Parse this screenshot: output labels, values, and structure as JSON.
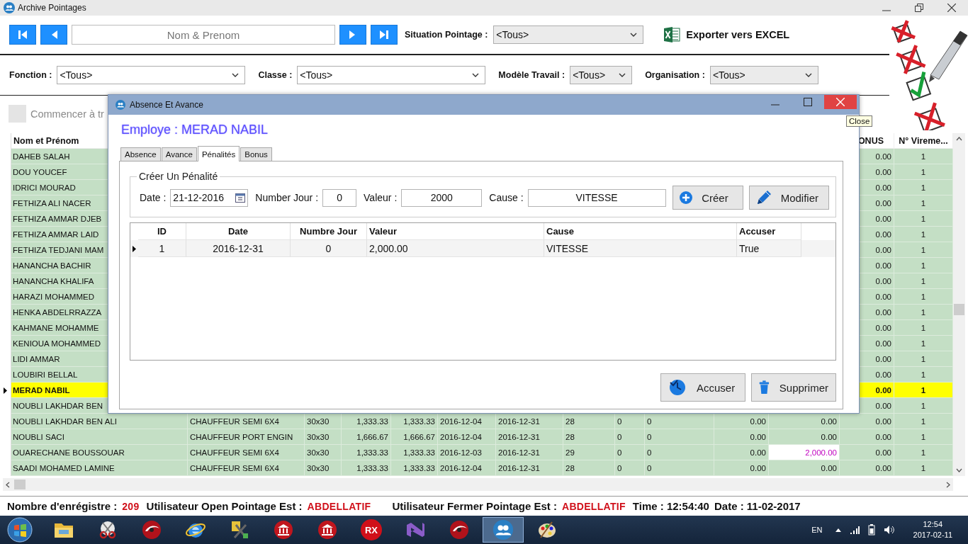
{
  "window": {
    "title": "Archive Pointages"
  },
  "search": {
    "placeholder": "Nom & Prenom"
  },
  "situation": {
    "label": "Situation Pointage :",
    "value": "<Tous>"
  },
  "export": {
    "label": "Exporter vers EXCEL"
  },
  "filters": [
    {
      "label": "Fonction :",
      "value": "<Tous>"
    },
    {
      "label": "Classe :",
      "value": "<Tous>"
    },
    {
      "label": "Modèle Travail :",
      "value": "<Tous>"
    },
    {
      "label": "Organisation :",
      "value": "<Tous>"
    }
  ],
  "start_option": {
    "label": "Commencer à tr",
    "checked": false
  },
  "table": {
    "columns": [
      {
        "label": "Nom et Prénom"
      },
      {
        "label": "ONUS"
      },
      {
        "label": "N° Vireme..."
      }
    ],
    "rows": [
      {
        "name": "DAHEB SALAH",
        "selected": false,
        "last_columns": [
          "0.00",
          "1"
        ]
      },
      {
        "name": "DOU YOUCEF",
        "selected": false,
        "last_columns": [
          "0.00",
          "1"
        ]
      },
      {
        "name": "IDRICI MOURAD",
        "selected": false,
        "last_columns": [
          "0.00",
          "1"
        ]
      },
      {
        "name": "FETHIZA ALI  NACER",
        "selected": false,
        "last_columns": [
          "0.00",
          "1"
        ]
      },
      {
        "name": "FETHIZA AMMAR DJEB",
        "selected": false,
        "last_columns": [
          "0.00",
          "1"
        ]
      },
      {
        "name": "FETHIZA AMMAR LAID",
        "selected": false,
        "last_columns": [
          "0.00",
          "1"
        ]
      },
      {
        "name": "FETHIZA TEDJANI MAM",
        "selected": false,
        "last_columns": [
          "0.00",
          "1"
        ]
      },
      {
        "name": "HANANCHA BACHIR",
        "selected": false,
        "last_columns": [
          "0.00",
          "1"
        ]
      },
      {
        "name": "HANANCHA KHALIFA",
        "selected": false,
        "last_columns": [
          "0.00",
          "1"
        ]
      },
      {
        "name": "HARAZI MOHAMMED",
        "selected": false,
        "last_columns": [
          "0.00",
          "1"
        ]
      },
      {
        "name": "HENKA ABDELRRAZZA",
        "selected": false,
        "last_columns": [
          "0.00",
          "1"
        ]
      },
      {
        "name": "KAHMANE  MOHAMME",
        "selected": false,
        "last_columns": [
          "0.00",
          "1"
        ]
      },
      {
        "name": "KENIOUA MOHAMMED",
        "selected": false,
        "last_columns": [
          "0.00",
          "1"
        ]
      },
      {
        "name": "LIDI AMMAR",
        "selected": false,
        "last_columns": [
          "0.00",
          "1"
        ]
      },
      {
        "name": "LOUBIRI BELLAL",
        "selected": false,
        "last_columns": [
          "0.00",
          "1"
        ]
      },
      {
        "name": "MERAD NABIL",
        "selected": true,
        "last_columns": [
          "0.00",
          "1"
        ]
      },
      {
        "name": "NOUBLI LAKHDAR BEN",
        "selected": false,
        "last_columns": [
          "0.00",
          "1"
        ]
      },
      {
        "name": "NOUBLI LAKHDAR BEN ALI",
        "selected": false,
        "details": [
          "CHAUFFEUR SEMI 6X4",
          "30x30",
          "1,333.33",
          "1,333.33",
          "2016-12-04",
          "2016-12-31",
          "28",
          "0",
          "0",
          "0.00"
        ],
        "penalty": {
          "text": "0.00",
          "highlighted": false
        },
        "last_columns": [
          "0.00",
          "1"
        ]
      },
      {
        "name": "NOUBLI  SACI",
        "selected": false,
        "details": [
          "CHAUFFEUR PORT ENGIN",
          "30x30",
          "1,666.67",
          "1,666.67",
          "2016-12-04",
          "2016-12-31",
          "28",
          "0",
          "0",
          "0.00"
        ],
        "penalty": {
          "text": "0.00",
          "highlighted": false
        },
        "last_columns": [
          "0.00",
          "1"
        ]
      },
      {
        "name": "OUARECHANE BOUSSOUAR",
        "selected": false,
        "details": [
          "CHAUFFEUR SEMI 6X4",
          "30x30",
          "1,333.33",
          "1,333.33",
          "2016-12-03",
          "2016-12-31",
          "29",
          "0",
          "0",
          "0.00"
        ],
        "penalty": {
          "text": "2,000.00",
          "highlighted": true
        },
        "last_columns": [
          "0.00",
          "1"
        ]
      },
      {
        "name": "SAADI MOHAMED LAMINE",
        "selected": false,
        "details": [
          "CHAUFFEUR SEMI 6X4",
          "30x30",
          "1,333.33",
          "1,333.33",
          "2016-12-04",
          "2016-12-31",
          "28",
          "0",
          "0",
          "0.00"
        ],
        "penalty": {
          "text": "0.00",
          "highlighted": false
        },
        "last_columns": [
          "0.00",
          "1"
        ]
      }
    ]
  },
  "dialog": {
    "title": "Absence Et Avance",
    "employee": "Employe : MERAD NABIL",
    "tabs": [
      {
        "label": "Absence",
        "selected": false
      },
      {
        "label": "Avance",
        "selected": false
      },
      {
        "label": "Pénalités",
        "selected": true
      },
      {
        "label": "Bonus",
        "selected": false
      }
    ],
    "group": {
      "title": "Créer Un Pénalité",
      "fields": [
        {
          "label": "Date :",
          "value": "21-12-2016",
          "kind": "date"
        },
        {
          "label": "Number Jour :",
          "value": "0",
          "kind": "text"
        },
        {
          "label": "Valeur :",
          "value": "2000",
          "kind": "text"
        },
        {
          "label": "Cause :",
          "value": "VITESSE",
          "kind": "text"
        }
      ],
      "buttons": [
        {
          "label": "Créer",
          "kind": "create"
        },
        {
          "label": "Modifier",
          "kind": "edit"
        }
      ]
    },
    "grid": {
      "columns": [
        "ID",
        "Date",
        "Numbre Jour",
        "Valeur",
        "Cause",
        "Accuser"
      ],
      "rows": [
        {
          "cells": [
            "1",
            "2016-12-31",
            "0",
            "2,000.00",
            "VITESSE",
            "True"
          ],
          "selected": true
        }
      ]
    },
    "buttons": [
      {
        "label": "Accuser",
        "kind": "accuse"
      },
      {
        "label": "Supprimer",
        "kind": "delete"
      }
    ]
  },
  "tooltip": {
    "text": "Close"
  },
  "status_bar": {
    "items": [
      {
        "label": "Nombre d'enrégistre :",
        "value": "209"
      },
      {
        "label": "Utilisateur Open Pointage Est :",
        "value": "ABDELLATIF"
      },
      {
        "label": "Utilisateur Fermer Pointage Est :",
        "value": "ABDELLATIF"
      }
    ],
    "time": "Time : 12:54:40",
    "date": "Date : 11-02-2017"
  },
  "taskbar": {
    "apps": [
      {
        "kind": "folder",
        "active": false
      },
      {
        "kind": "scissors",
        "active": false
      },
      {
        "kind": "disc",
        "active": false
      },
      {
        "kind": "browser",
        "active": false
      },
      {
        "kind": "tools",
        "active": false
      },
      {
        "kind": "bank",
        "active": false
      },
      {
        "kind": "bank",
        "active": false
      },
      {
        "kind": "rx",
        "label": "RX",
        "active": false
      },
      {
        "kind": "studio",
        "active": false
      },
      {
        "kind": "disc",
        "active": false
      },
      {
        "kind": "users",
        "active": true
      },
      {
        "kind": "paint",
        "active": false
      }
    ],
    "tray": {
      "language": "EN",
      "time": "12:54",
      "date": "2017-02-11"
    }
  }
}
